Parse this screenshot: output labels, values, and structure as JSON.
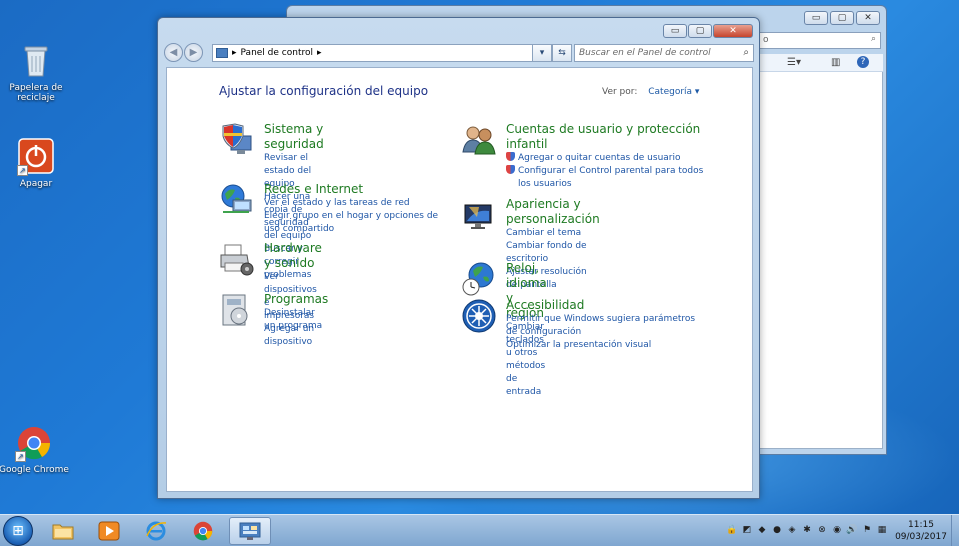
{
  "desktop": {
    "icons": [
      {
        "label": "Papelera de reciclaje",
        "icon": "recycle-bin-icon"
      },
      {
        "label": "Apagar",
        "icon": "power-icon"
      },
      {
        "label": "Google Chrome",
        "icon": "chrome-icon"
      }
    ]
  },
  "back_window": {
    "search_text": "o",
    "buttons": {
      "minimize": "▭",
      "maximize": "▢",
      "close": "✕"
    }
  },
  "window": {
    "buttons": {
      "minimize": "▭",
      "maximize": "▢",
      "close": "✕"
    },
    "breadcrumb": "Panel de control",
    "search_placeholder": "Buscar en el Panel de control",
    "page_title": "Ajustar la configuración del equipo",
    "view_by_label": "Ver por:",
    "view_by_value": "Categoría ▾"
  },
  "categories": [
    {
      "title": "Sistema y seguridad",
      "icon": "shield-pc-icon",
      "links": [
        "Revisar el estado del equipo",
        "Hacer una copia de seguridad del equipo",
        "Buscar y corregir problemas"
      ]
    },
    {
      "title": "Redes e Internet",
      "icon": "network-globe-icon",
      "links": [
        "Ver el estado y las tareas de red",
        "Elegir grupo en el hogar y opciones de uso compartido"
      ]
    },
    {
      "title": "Hardware y sonido",
      "icon": "printer-icon",
      "links": [
        "Ver dispositivos e impresoras",
        "Agregar un dispositivo"
      ]
    },
    {
      "title": "Programas",
      "icon": "programs-icon",
      "links": [
        "Desinstalar un programa"
      ]
    },
    {
      "title": "Cuentas de usuario y protección infantil",
      "icon": "users-icon",
      "links": [
        "Agregar o quitar cuentas de usuario",
        "Configurar el Control parental para todos los usuarios"
      ]
    },
    {
      "title": "Apariencia y personalización",
      "icon": "display-icon",
      "links": [
        "Cambiar el tema",
        "Cambiar fondo de escritorio",
        "Ajustar resolución de pantalla"
      ]
    },
    {
      "title": "Reloj, idioma y región",
      "icon": "clock-globe-icon",
      "links": [
        "Cambiar teclados u otros métodos de entrada"
      ]
    },
    {
      "title": "Accesibilidad",
      "icon": "accessibility-icon",
      "links": [
        "Permitir que Windows sugiera parámetros de configuración",
        "Optimizar la presentación visual"
      ]
    }
  ],
  "taskbar": {
    "clock_time": "11:15",
    "clock_date": "09/03/2017"
  }
}
